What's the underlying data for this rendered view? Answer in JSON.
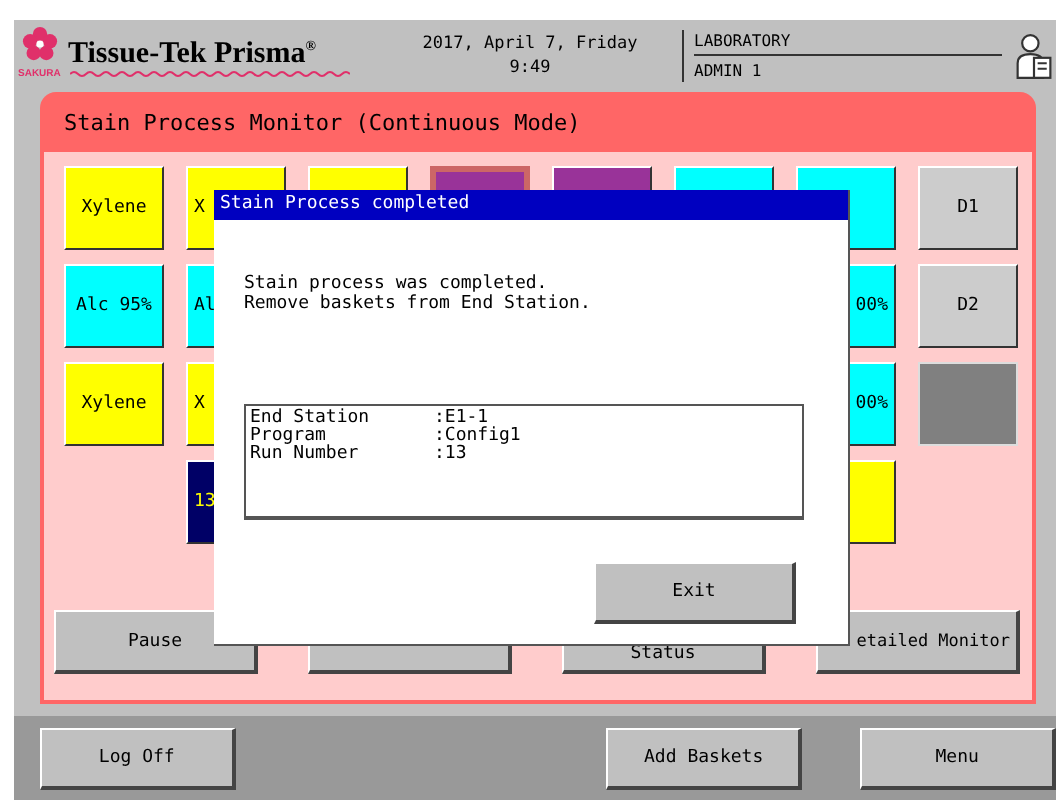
{
  "header": {
    "brand": "Tissue-Tek Prisma$^{®}$",
    "maker": "SAKURA",
    "date": "2017, April 7, Friday",
    "time": "9:49",
    "location": "LABORATORY",
    "user": "ADMIN 1"
  },
  "panel": {
    "title": "Stain Process Monitor (Continuous Mode)",
    "rows": [
      [
        {
          "kind": "tile",
          "label": "Xylene",
          "color": "#ffff00",
          "highlighted": false
        },
        {
          "kind": "tile",
          "label": "X",
          "color": "#ffff00",
          "highlighted": false
        },
        {
          "kind": "tile",
          "color": "#ffff00",
          "highlighted": false
        },
        {
          "kind": "tile",
          "color": "#993399",
          "highlighted": true
        },
        {
          "kind": "tile",
          "color": "#993399",
          "highlighted": false
        },
        {
          "kind": "tile",
          "color": "#00ffff",
          "highlighted": false
        },
        {
          "kind": "tile",
          "color": "#00ffff",
          "highlighted": false
        },
        {
          "kind": "tile",
          "label": "D1",
          "color": "#cccccc",
          "highlighted": false
        }
      ],
      [
        {
          "kind": "tile",
          "label": "Alc 95%",
          "color": "#00ffff",
          "highlighted": false
        },
        {
          "kind": "tile",
          "label": "Al",
          "color": "#00ffff",
          "highlighted": false
        },
        {
          "kind": "blank"
        },
        {
          "kind": "blank"
        },
        {
          "kind": "blank"
        },
        {
          "kind": "blank"
        },
        {
          "kind": "tile",
          "label": "00%",
          "color": "#00ffff",
          "highlighted": false
        },
        {
          "kind": "tile",
          "label": "D2",
          "color": "#cccccc",
          "highlighted": false
        }
      ],
      [
        {
          "kind": "tile",
          "label": "Xylene",
          "color": "#ffff00",
          "highlighted": false
        },
        {
          "kind": "tile",
          "label": "X",
          "color": "#ffff00",
          "highlighted": false
        },
        {
          "kind": "blank"
        },
        {
          "kind": "blank"
        },
        {
          "kind": "blank"
        },
        {
          "kind": "blank"
        },
        {
          "kind": "tile",
          "label": "00%",
          "color": "#00ffff",
          "highlighted": false
        },
        {
          "kind": "slot",
          "color": "#808080"
        }
      ],
      [
        {
          "kind": "blank"
        },
        {
          "kind": "tile",
          "label": "13",
          "color": "#000066",
          "highlighted": false
        },
        {
          "kind": "blank"
        },
        {
          "kind": "blank"
        },
        {
          "kind": "blank"
        },
        {
          "kind": "blank"
        },
        {
          "kind": "tile",
          "color": "#ffff00",
          "highlighted": false
        },
        {
          "kind": "blank"
        }
      ]
    ],
    "buttons": [
      {
        "label": "Pause",
        "kind": "plain"
      },
      {
        "kind": "covered"
      },
      {
        "label": "Status",
        "kind": "lower"
      },
      {
        "label": "etailed Monitor",
        "kind": "right"
      }
    ]
  },
  "dialog": {
    "title": "Stain Process completed",
    "message": [
      "Stain process was completed.",
      "Remove baskets from End Station."
    ],
    "details": [
      {
        "label": "End Station",
        "value": ":E1-1"
      },
      {
        "label": "Program",
        "value": ":Config1"
      },
      {
        "label": "Run Number",
        "value": ":13"
      }
    ],
    "button": "Exit"
  },
  "footer": {
    "buttons": [
      {
        "label": "Log Off",
        "kind": "button"
      },
      {
        "kind": "gap"
      },
      {
        "label": "Add Baskets",
        "kind": "button"
      },
      {
        "label": "Menu",
        "kind": "button"
      }
    ]
  }
}
